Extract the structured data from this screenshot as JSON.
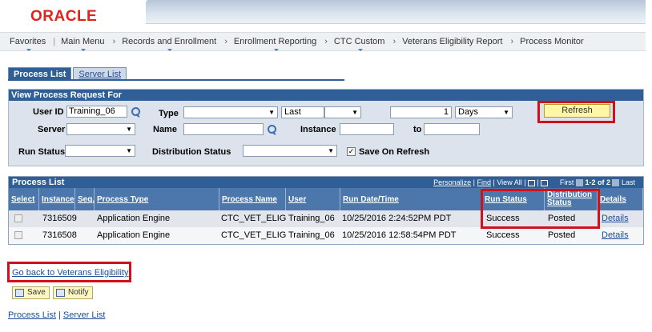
{
  "brand": {
    "logo_text": "ORACLE",
    "logo_color": "#e2231a"
  },
  "nav": {
    "favorites": "Favorites",
    "main_menu": "Main Menu",
    "crumbs": [
      "Records and Enrollment",
      "Enrollment Reporting",
      "CTC Custom",
      "Veterans Eligibility Report",
      "Process Monitor"
    ]
  },
  "tabs": {
    "process_list": "Process List",
    "server_list": "Server List"
  },
  "filters": {
    "title": "View Process Request For",
    "user_id_label": "User ID",
    "user_id_value": "Training_06",
    "type_label": "Type",
    "type_value": "",
    "last_value": "Last",
    "last_select_value": "",
    "last_number": "1",
    "days_value": "Days",
    "refresh_label": "Refresh",
    "server_label": "Server",
    "server_value": "",
    "name_label": "Name",
    "name_value": "",
    "instance_label": "Instance",
    "instance_from": "",
    "to_label": "to",
    "instance_to": "",
    "run_status_label": "Run Status",
    "run_status_value": "",
    "dist_status_label": "Distribution Status",
    "dist_status_value": "",
    "save_on_refresh_label": "Save On Refresh",
    "save_on_refresh_checked": true
  },
  "process_list": {
    "title": "Process List",
    "personalize": "Personalize",
    "find": "Find",
    "view_all": "View All",
    "first": "First",
    "range": "1-2 of 2",
    "last": "Last",
    "columns": [
      "Select",
      "Instance",
      "Seq.",
      "Process Type",
      "Process Name",
      "User",
      "Run Date/Time",
      "Run Status",
      "Distribution Status",
      "Details"
    ],
    "rows": [
      {
        "instance": "7316509",
        "seq": "",
        "process_type": "Application Engine",
        "process_name": "CTC_VET_ELIG",
        "user": "Training_06",
        "run_datetime": "10/25/2016  2:24:52PM PDT",
        "run_status": "Success",
        "distribution_status": "Posted",
        "details": "Details"
      },
      {
        "instance": "7316508",
        "seq": "",
        "process_type": "Application Engine",
        "process_name": "CTC_VET_ELIG",
        "user": "Training_06",
        "run_datetime": "10/25/2016 12:58:54PM PDT",
        "run_status": "Success",
        "distribution_status": "Posted",
        "details": "Details"
      }
    ]
  },
  "go_back_link": "Go back to Veterans Eligibility",
  "buttons": {
    "save": "Save",
    "notify": "Notify"
  },
  "footer": {
    "process_list": "Process List",
    "server_list": "Server List"
  }
}
